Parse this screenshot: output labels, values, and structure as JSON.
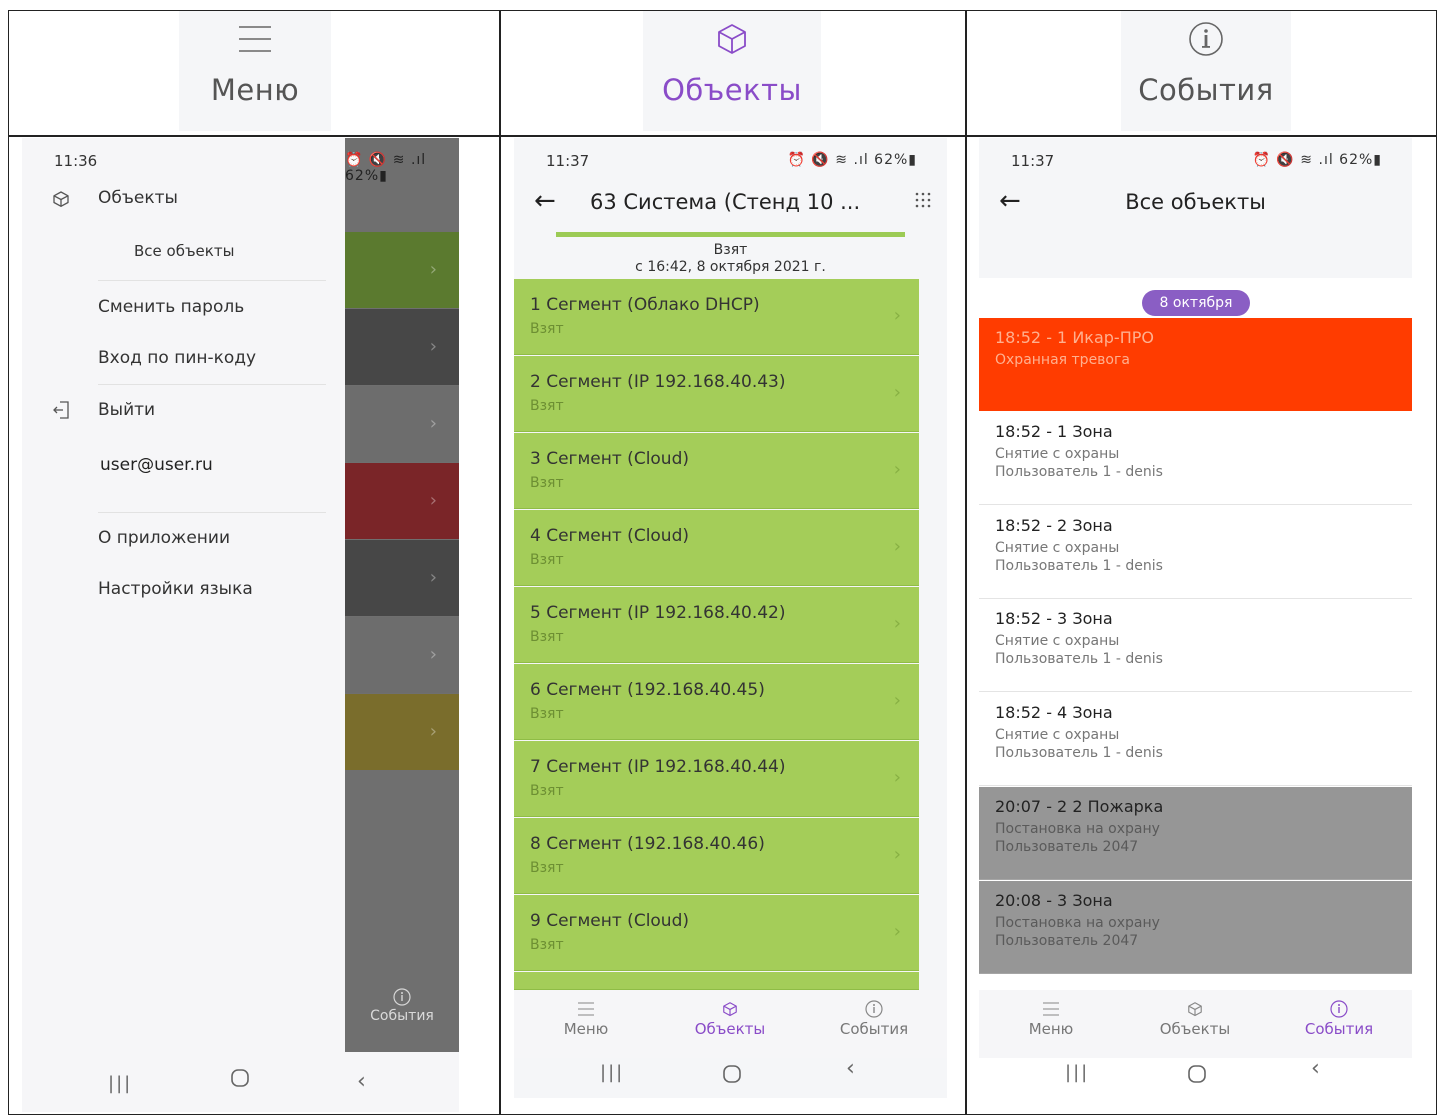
{
  "header": {
    "menu_label": "Меню",
    "objects_label": "Объекты",
    "events_label": "События"
  },
  "screen1": {
    "time": "11:36",
    "status_icons": "⏰ 🔇 ≋ .ıl 62%▮",
    "items": {
      "objects": "Объекты",
      "all_objects": "Все объекты",
      "change_password": "Сменить пароль",
      "pin_login": "Вход по пин-коду",
      "logout": "Выйти",
      "user": "user@user.ru",
      "about": "О приложении",
      "language": "Настройки языка"
    },
    "overlay_events": "События",
    "overlay_colors": [
      "#6f6f6f",
      "#5b7a2f",
      "#474747",
      "#6d6d6d",
      "#7a2528",
      "#474747",
      "#6d6d6d",
      "#7a6d2c"
    ]
  },
  "screen2": {
    "time": "11:37",
    "status_icons": "⏰ 🔇 ≋ .ıl 62%▮",
    "title": "63 Система (Стенд 10 ...",
    "state": "Взят",
    "state_since": "с 16:42, 8 октября 2021 г.",
    "segments": [
      {
        "title": "1 Сегмент (Облако DHCP)",
        "status": "Взят"
      },
      {
        "title": "2 Сегмент (IP 192.168.40.43)",
        "status": "Взят"
      },
      {
        "title": "3 Сегмент (Cloud)",
        "status": "Взят"
      },
      {
        "title": "4 Сегмент (Cloud)",
        "status": "Взят"
      },
      {
        "title": "5 Сегмент (IP 192.168.40.42)",
        "status": "Взят"
      },
      {
        "title": "6 Сегмент (192.168.40.45)",
        "status": "Взят"
      },
      {
        "title": "7 Сегмент (IP 192.168.40.44)",
        "status": "Взят"
      },
      {
        "title": "8 Сегмент (192.168.40.46)",
        "status": "Взят"
      },
      {
        "title": "9 Сегмент (Cloud)",
        "status": "Взят"
      }
    ],
    "tabs": {
      "menu": "Меню",
      "objects": "Объекты",
      "events": "События"
    }
  },
  "screen3": {
    "time": "11:37",
    "status_icons": "⏰ 🔇 ≋ .ıl 62%▮",
    "title": "Все объекты",
    "date": "8 октября",
    "events": [
      {
        "title": "18:52 - 1 Икар-ПРО",
        "line1": "Охранная тревога",
        "line2": ""
      },
      {
        "title": "18:52 - 1 Зона",
        "line1": "Снятие с охраны",
        "line2": "Пользователь 1 - denis"
      },
      {
        "title": "18:52 - 2 Зона",
        "line1": "Снятие с охраны",
        "line2": "Пользователь 1 - denis"
      },
      {
        "title": "18:52 - 3 Зона",
        "line1": "Снятие с охраны",
        "line2": "Пользователь 1 - denis"
      },
      {
        "title": "18:52 - 4 Зона",
        "line1": "Снятие с охраны",
        "line2": "Пользователь 1 - denis"
      },
      {
        "title": "20:07 - 2 2 Пожарка",
        "line1": "Постановка на охрану",
        "line2": "Пользователь 2047"
      },
      {
        "title": "20:08 - 3 Зона",
        "line1": "Постановка на охрану",
        "line2": "Пользователь 2047"
      }
    ],
    "tabs": {
      "menu": "Меню",
      "objects": "Объекты",
      "events": "События"
    }
  },
  "colors": {
    "accent": "#8a4cc8",
    "segment_green": "#a4cd59",
    "alarm_red": "#ff3c00",
    "event_grey": "#969696"
  }
}
